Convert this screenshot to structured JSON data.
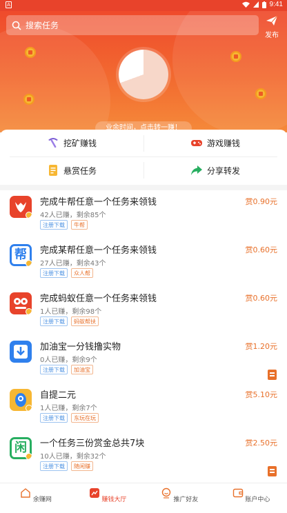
{
  "status_bar": {
    "time": "9:41",
    "left_icon": "A"
  },
  "header": {
    "search_placeholder": "搜索任务",
    "publish_label": "发布"
  },
  "hero": {
    "dial_fraction_filled": 0.3,
    "tagline": "业余时间，点击转一赚！"
  },
  "quick_menu": [
    {
      "label": "挖矿赚钱",
      "icon": "pickaxe-icon"
    },
    {
      "label": "游戏赚钱",
      "icon": "gamepad-icon"
    },
    {
      "label": "悬赏任务",
      "icon": "document-icon"
    },
    {
      "label": "分享转发",
      "icon": "share-arrow-icon"
    }
  ],
  "tasks": [
    {
      "title": "完成牛帮任意一个任务来领钱",
      "earned": "42人已赚",
      "remaining": "剩余85个",
      "tags": [
        "注册下载",
        "牛帮"
      ],
      "reward": "赏0.90元",
      "icon": "niubang-app-icon",
      "icon_color": "#e8432b",
      "icon_text": "",
      "has_clip": false
    },
    {
      "title": "完成某帮任意一个任务来领钱",
      "earned": "27人已赚",
      "remaining": "剩余43个",
      "tags": [
        "注册下载",
        "众人帮"
      ],
      "reward": "赏0.60元",
      "icon": "zhongrenbang-app-icon",
      "icon_color": "#2f80ed",
      "icon_text": "帮",
      "has_clip": false
    },
    {
      "title": "完成蚂蚁任意一个任务来领钱",
      "earned": "1人已赚",
      "remaining": "剩余98个",
      "tags": [
        "注册下载",
        "蚂蚁帮扶"
      ],
      "reward": "赏0.60元",
      "icon": "mayi-app-icon",
      "icon_color": "#e8432b",
      "icon_text": "",
      "has_clip": false
    },
    {
      "title": "加油宝一分钱撸实物",
      "earned": "0人已赚",
      "remaining": "剩余9个",
      "tags": [
        "注册下载",
        "加油宝"
      ],
      "reward": "赏1.20元",
      "icon": "download-app-icon",
      "icon_color": "#2f80ed",
      "icon_text": "",
      "has_clip": true
    },
    {
      "title": "自提二元",
      "earned": "1人已赚",
      "remaining": "剩余7个",
      "tags": [
        "注册下载",
        "东玩在玩"
      ],
      "reward": "赏5.10元",
      "icon": "dongwan-app-icon",
      "icon_color": "#f7b733",
      "icon_text": "",
      "has_clip": false
    },
    {
      "title": "一个任务三份赏金总共7块",
      "earned": "10人已赚",
      "remaining": "剩余32个",
      "tags": [
        "注册下载",
        "随闲赚"
      ],
      "reward": "赏2.50元",
      "icon": "xian-app-icon",
      "icon_color": "#27ae60",
      "icon_text": "闲",
      "has_clip": true
    }
  ],
  "bottom_nav": [
    {
      "label": "余赚网",
      "icon": "home-icon",
      "active": false
    },
    {
      "label": "赚钱大厅",
      "icon": "chart-icon",
      "active": true
    },
    {
      "label": "推广好友",
      "icon": "smile-icon",
      "active": false
    },
    {
      "label": "账户中心",
      "icon": "wallet-icon",
      "active": false
    }
  ],
  "colors": {
    "accent": "#e8432b",
    "reward": "#e8702a",
    "tag_blue": "#4a90e2"
  }
}
